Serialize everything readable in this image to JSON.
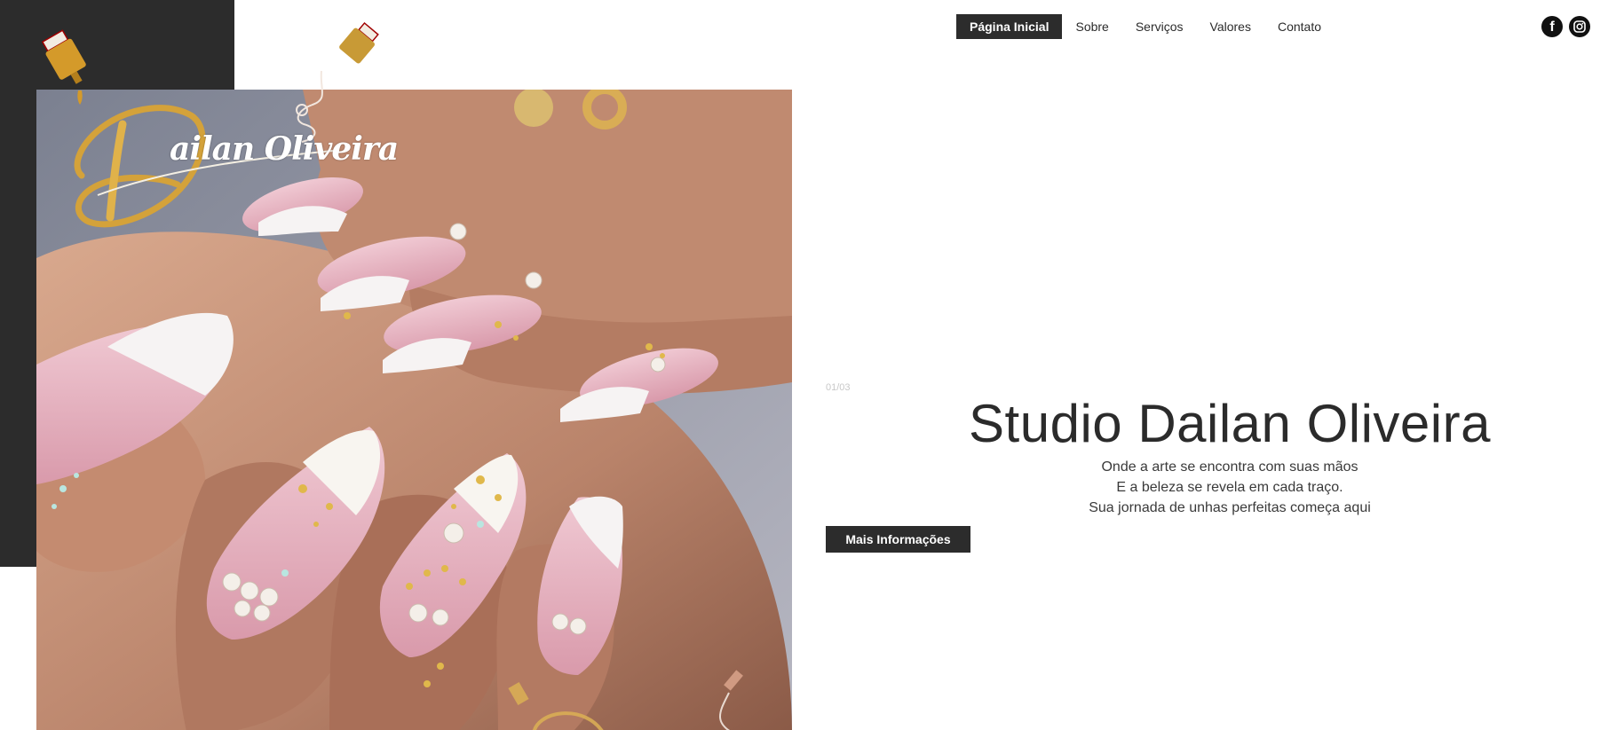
{
  "nav": {
    "items": [
      {
        "label": "Página Inicial",
        "active": true
      },
      {
        "label": "Sobre",
        "active": false
      },
      {
        "label": "Serviços",
        "active": false
      },
      {
        "label": "Valores",
        "active": false
      },
      {
        "label": "Contato",
        "active": false
      }
    ]
  },
  "social": {
    "facebook_icon": "facebook-icon",
    "instagram_icon": "instagram-icon"
  },
  "logo": {
    "text": "ailan Oliveira"
  },
  "hero": {
    "slide_counter": "01/03",
    "title": "Studio Dailan Oliveira",
    "lines": [
      "Onde a arte se encontra com suas mãos",
      "E a beleza se revela em cada traço.",
      "Sua jornada de unhas perfeitas começa aqui"
    ],
    "cta_label": "Mais Informações"
  },
  "colors": {
    "dark": "#2c2c2c",
    "gold": "#d4a23a",
    "text": "#2b2b2b",
    "background": "#ffffff"
  }
}
